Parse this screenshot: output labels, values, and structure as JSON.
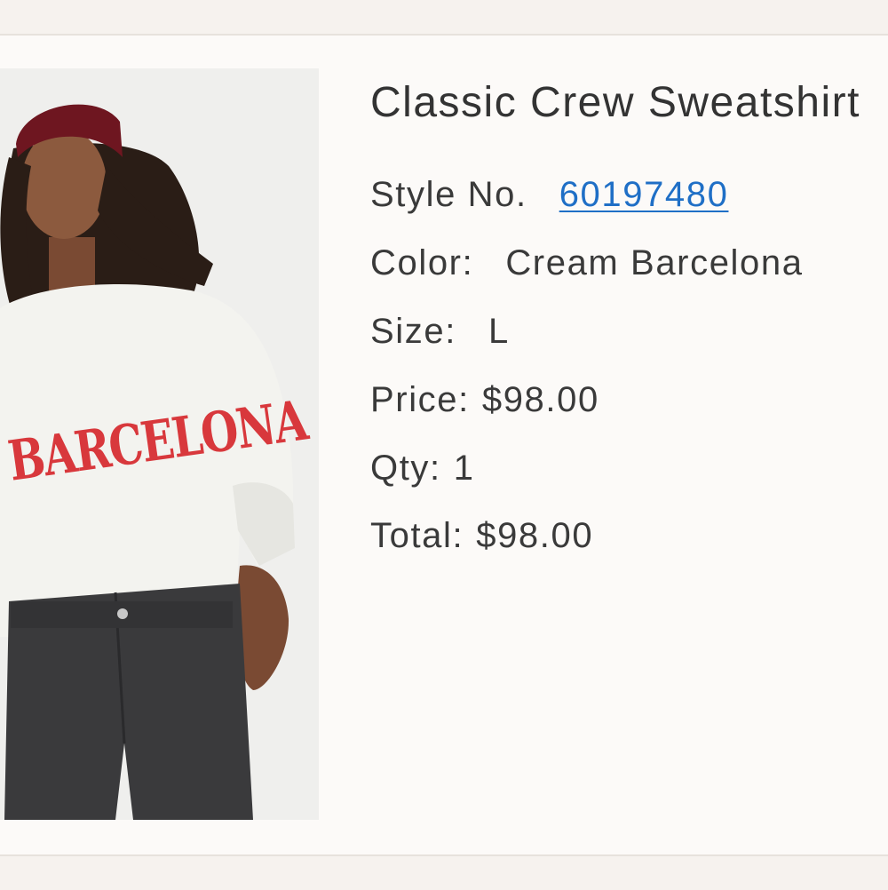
{
  "product": {
    "title": "Classic Crew Sweatshirt",
    "image_alt": "Model wearing cream sweatshirt with red BARCELONA lettering and dark jeans",
    "image_print_text": "BARCELONA",
    "style_label": "Style No.",
    "style_number": "60197480",
    "color_label": "Color:",
    "color_value": "Cream Barcelona",
    "size_label": "Size:",
    "size_value": "L",
    "price_label": "Price:",
    "price_value": "$98.00",
    "qty_label": "Qty:",
    "qty_value": "1",
    "total_label": "Total:",
    "total_value": "$98.00"
  },
  "colors": {
    "link": "#1f6fc6",
    "text": "#3a3a3a",
    "print_red": "#d8383c",
    "background": "#fcfaf8"
  }
}
